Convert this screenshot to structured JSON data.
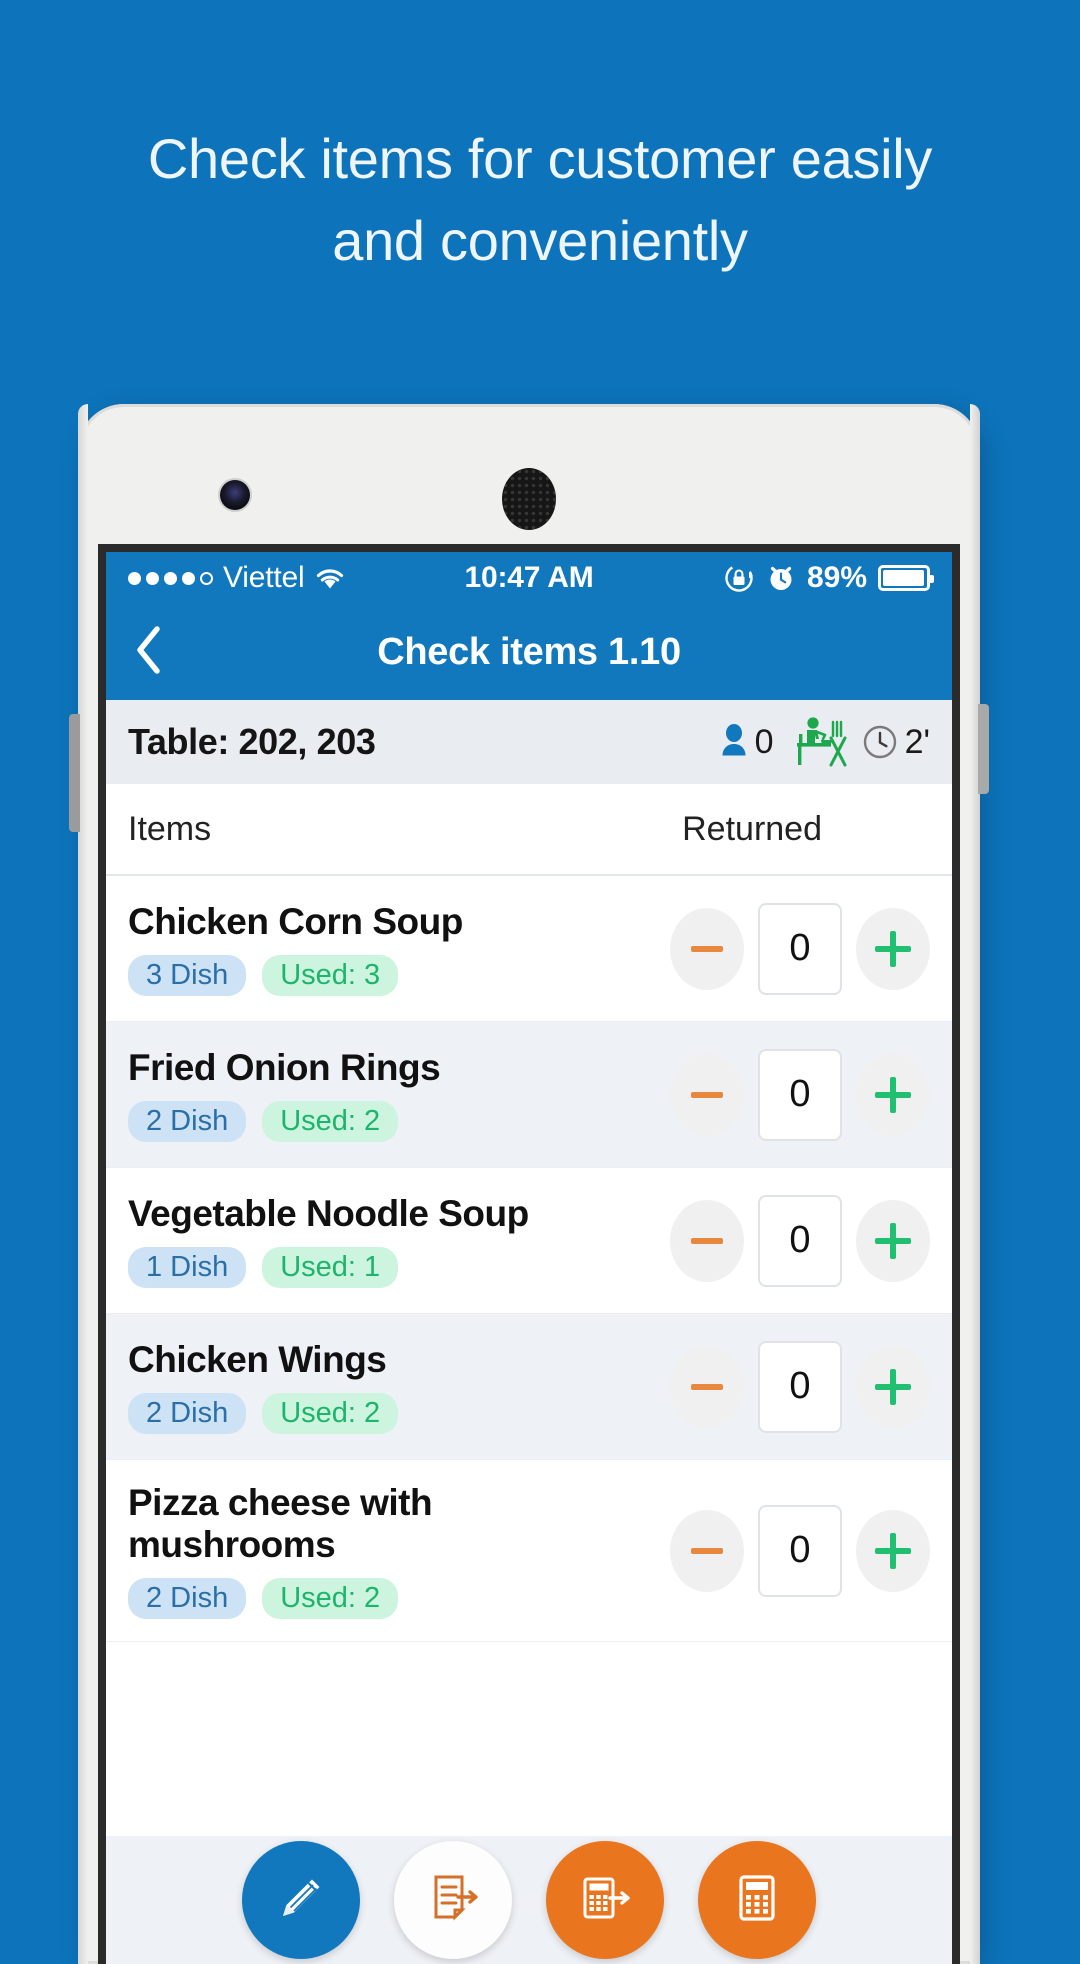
{
  "promo": {
    "headline_line1": "Check items for customer easily",
    "headline_line2": "and conveniently",
    "background_color": "#0d74bb"
  },
  "status_bar": {
    "carrier": "Viettel",
    "signal_dots_filled": 4,
    "signal_dots_total": 5,
    "wifi_icon": "wifi-icon",
    "time": "10:47 AM",
    "rotation_lock_icon": "rotation-lock-icon",
    "alarm_icon": "alarm-clock-icon",
    "battery_percent": "89%",
    "battery_icon": "battery-icon"
  },
  "navbar": {
    "back_icon": "chevron-left-icon",
    "title": "Check items 1.10",
    "accent_color": "#1278be"
  },
  "table_bar": {
    "label": "Table: 202, 203",
    "guest_icon": "person-icon",
    "guest_count": "0",
    "dining_icon": "person-dining-icon",
    "clock_icon": "clock-icon",
    "elapsed": "2'"
  },
  "columns": {
    "items": "Items",
    "returned": "Returned"
  },
  "items": [
    {
      "name": "Chicken Corn Soup",
      "dish_badge": "3 Dish",
      "used_badge": "Used: 3",
      "returned_qty": "0"
    },
    {
      "name": "Fried Onion Rings",
      "dish_badge": "2 Dish",
      "used_badge": "Used: 2",
      "returned_qty": "0"
    },
    {
      "name": "Vegetable Noodle Soup",
      "dish_badge": "1 Dish",
      "used_badge": "Used: 1",
      "returned_qty": "0"
    },
    {
      "name": "Chicken Wings",
      "dish_badge": "2 Dish",
      "used_badge": "Used: 2",
      "returned_qty": "0"
    },
    {
      "name": "Pizza cheese with mushrooms",
      "dish_badge": "2 Dish",
      "used_badge": "Used: 2",
      "returned_qty": "0"
    }
  ],
  "stepper": {
    "minus_icon": "minus-icon",
    "plus_icon": "plus-icon",
    "minus_color": "#e8883e",
    "plus_color": "#20c070"
  },
  "action_bar": {
    "buttons": [
      {
        "icon": "pencil-edit-icon",
        "style": "blue"
      },
      {
        "icon": "document-transfer-icon",
        "style": "white"
      },
      {
        "icon": "calculator-transfer-icon",
        "style": "orange"
      },
      {
        "icon": "calculator-icon",
        "style": "orange"
      }
    ]
  },
  "badge_colors": {
    "dish_bg": "#cde3f5",
    "dish_text": "#2a6fa8",
    "used_bg": "#ccf4de",
    "used_text": "#1db56b"
  }
}
